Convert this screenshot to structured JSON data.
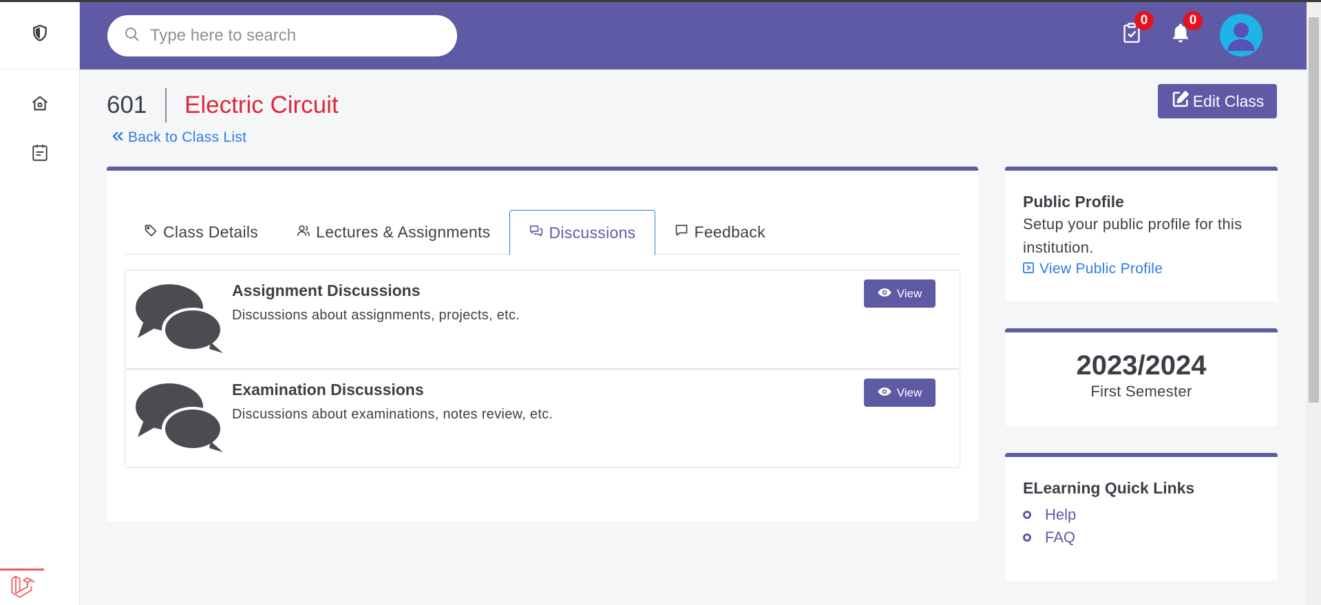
{
  "header": {
    "search_placeholder": "Type here to search",
    "tasks_count": "0",
    "notifications_count": "0"
  },
  "class": {
    "code": "601",
    "name": "Electric Circuit",
    "back_label": "Back to Class List",
    "edit_label": "Edit Class"
  },
  "tabs": [
    {
      "label": "Class Details",
      "icon": "tag-icon"
    },
    {
      "label": "Lectures & Assignments",
      "icon": "users-icon"
    },
    {
      "label": "Discussions",
      "icon": "chat-bubbles-icon",
      "active": true
    },
    {
      "label": "Feedback",
      "icon": "comment-icon"
    }
  ],
  "discussions": [
    {
      "title": "Assignment Discussions",
      "description": "Discussions about assignments, projects, etc.",
      "button": "View"
    },
    {
      "title": "Examination Discussions",
      "description": "Discussions about examinations, notes review, etc.",
      "button": "View"
    }
  ],
  "public_profile": {
    "title": "Public Profile",
    "text": "Setup your public profile for this institution.",
    "link": "View Public Profile"
  },
  "session": {
    "year": "2023/2024",
    "semester": "First Semester"
  },
  "quick_links": {
    "title": "ELearning Quick Links",
    "items": [
      "Help",
      "FAQ"
    ]
  },
  "colors": {
    "primary": "#5f5aa6",
    "title_red": "#e0283a",
    "link_blue": "#2f7ae5",
    "badge_red": "#e8101f"
  }
}
